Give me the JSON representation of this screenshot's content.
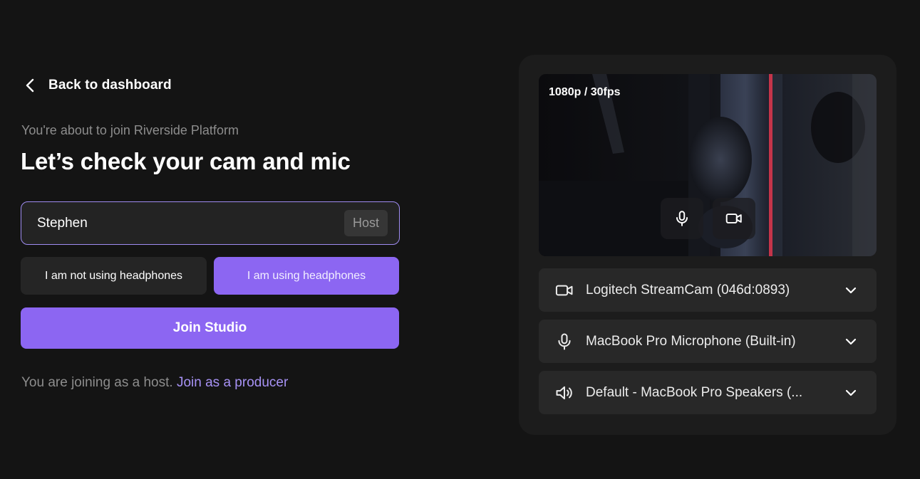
{
  "nav": {
    "back_label": "Back to dashboard"
  },
  "join": {
    "subtitle": "You're about to join Riverside Platform",
    "title": "Let’s check your cam and mic",
    "name_value": "Stephen",
    "role_badge": "Host",
    "headphones_off_label": "I am not using headphones",
    "headphones_on_label": "I am using headphones",
    "headphones_selected": "I am using headphones",
    "join_button_label": "Join Studio",
    "footer_text": "You are joining as a host.",
    "producer_link_label": "Join as a producer"
  },
  "preview": {
    "resolution_label": "1080p / 30fps",
    "mic_icon": "microphone-icon",
    "cam_icon": "video-camera-icon"
  },
  "devices": {
    "camera": {
      "label": "Logitech StreamCam (046d:0893)",
      "icon": "video-camera-icon"
    },
    "microphone": {
      "label": "MacBook Pro Microphone (Built-in)",
      "icon": "microphone-icon"
    },
    "speaker": {
      "label": "Default - MacBook Pro Speakers (...",
      "icon": "speaker-icon"
    }
  },
  "colors": {
    "background": "#141414",
    "panel": "#1c1c1c",
    "accent": "#8c66f2",
    "accent_border": "#9f8cf2",
    "link": "#a792f5",
    "muted_text": "#8d8d8d"
  }
}
